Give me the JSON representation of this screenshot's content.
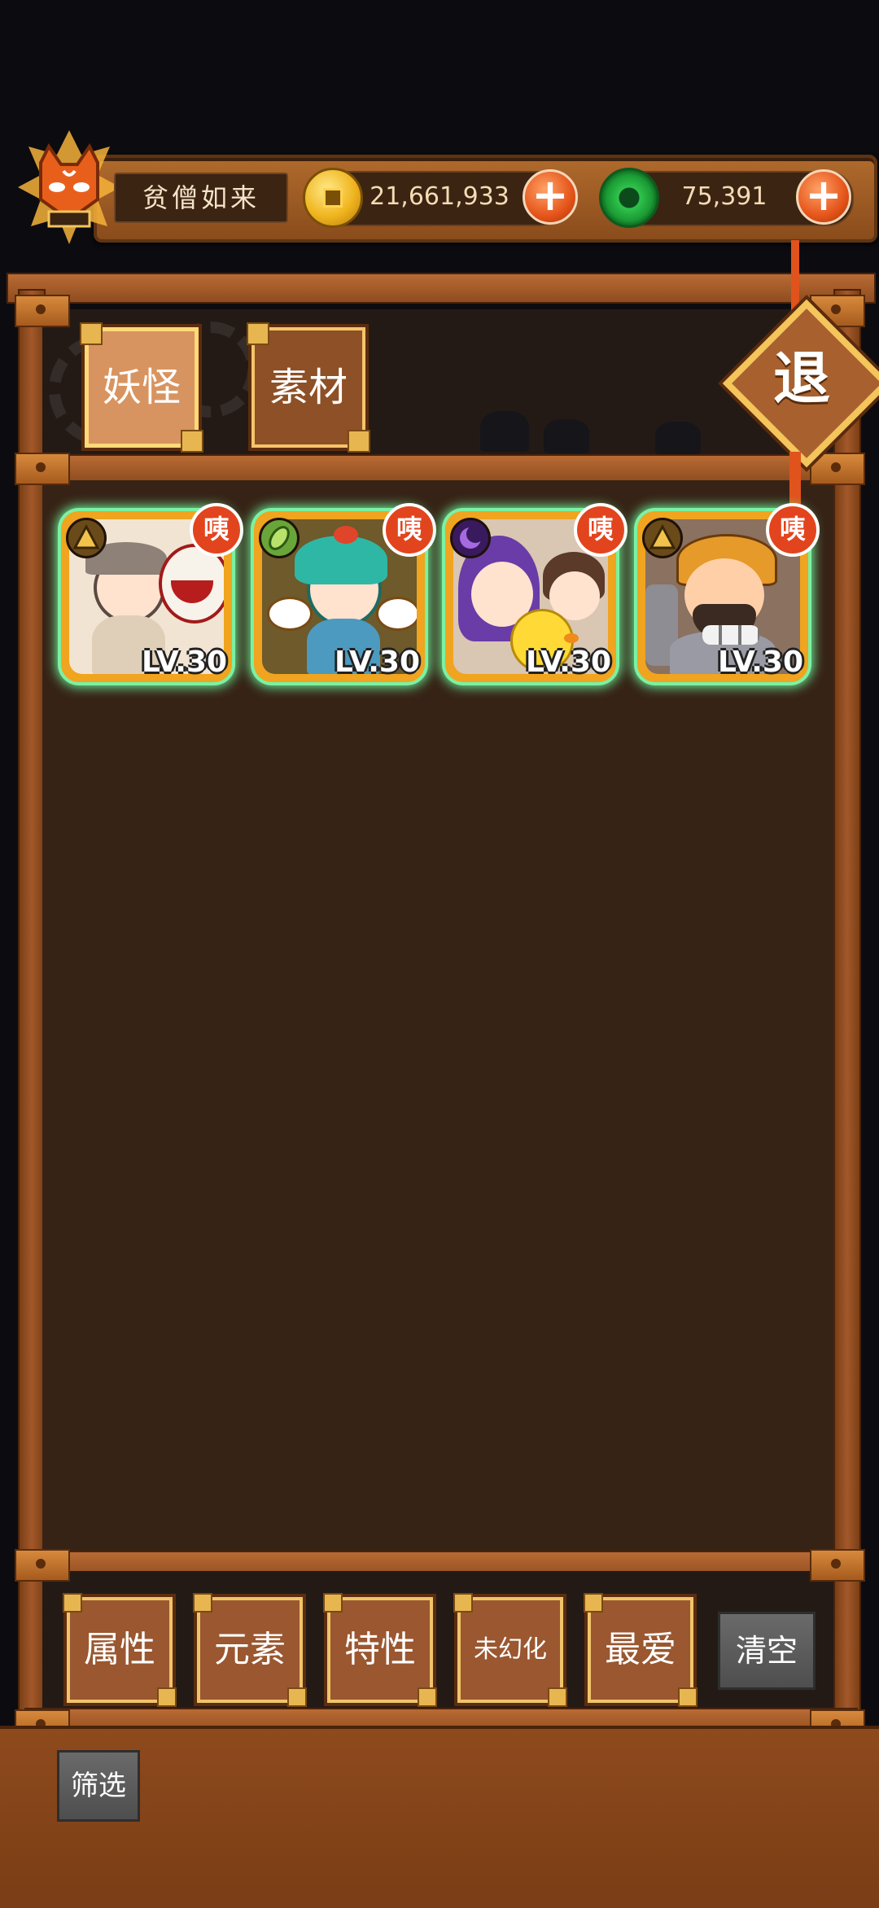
{
  "player": {
    "name": "贫僧如来",
    "avatar_icon": "fox-mask-icon"
  },
  "resources": {
    "coins": "21,661,933",
    "jade": "75,391",
    "coin_icon": "gold-coin-icon",
    "jade_icon": "jade-ring-icon",
    "add_symbol": "+"
  },
  "tabs": [
    {
      "label": "妖怪",
      "selected": true
    },
    {
      "label": "素材",
      "selected": false
    }
  ],
  "exit": {
    "label": "退"
  },
  "cards": [
    {
      "level": "LV.30",
      "badge": "咦",
      "element_color": "#6b4a1a",
      "element_icon": "triangle-element-icon",
      "bg": "#f2e4d2"
    },
    {
      "level": "LV.30",
      "badge": "咦",
      "element_color": "#6aa53a",
      "element_icon": "leaf-element-icon",
      "bg": "#6e5a2a"
    },
    {
      "level": "LV.30",
      "badge": "咦",
      "element_color": "#3a1a5e",
      "element_icon": "moon-element-icon",
      "bg": "#d9c7b3"
    },
    {
      "level": "LV.30",
      "badge": "咦",
      "element_color": "#6b4a1a",
      "element_icon": "triangle-element-icon",
      "bg": "#8a7160"
    }
  ],
  "filters": [
    {
      "label": "属性"
    },
    {
      "label": "元素"
    },
    {
      "label": "特性"
    },
    {
      "label": "未幻化"
    },
    {
      "label": "最爱"
    }
  ],
  "clear_button": "清空",
  "filter_button": "筛选",
  "colors": {
    "wood": "#8e4a1d",
    "card_glow": "#6df29c",
    "badge": "#e2441e"
  }
}
